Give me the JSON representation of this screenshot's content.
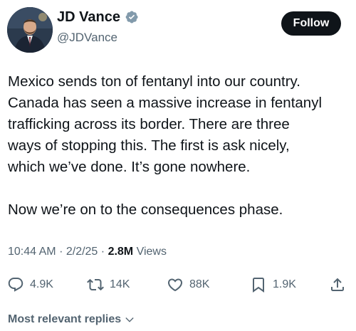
{
  "author": {
    "display_name": "JD Vance",
    "handle": "@JDVance",
    "verified_color": "#829aab"
  },
  "follow_button": {
    "label": "Follow"
  },
  "tweet": {
    "lines_p1": [
      "Mexico sends ton of fentanyl into our country.",
      "Canada has seen a massive increase in fentanyl",
      "trafficking across its border. There are three",
      "ways of stopping this. The first is ask nicely,",
      "which we’ve done. It’s gone nowhere."
    ],
    "lines_p2": [
      "Now we’re on to the consequences phase."
    ]
  },
  "meta": {
    "time": "10:44 AM",
    "separator": "·",
    "date": "2/2/25",
    "views_count": "2.8M",
    "views_label": "Views"
  },
  "actions": {
    "replies": "4.9K",
    "reposts": "14K",
    "likes": "88K",
    "bookmarks": "1.9K"
  },
  "replies_sort": {
    "label": "Most relevant replies"
  },
  "colors": {
    "text": "#0f1419",
    "secondary": "#536471",
    "button_bg": "#0f1419"
  }
}
